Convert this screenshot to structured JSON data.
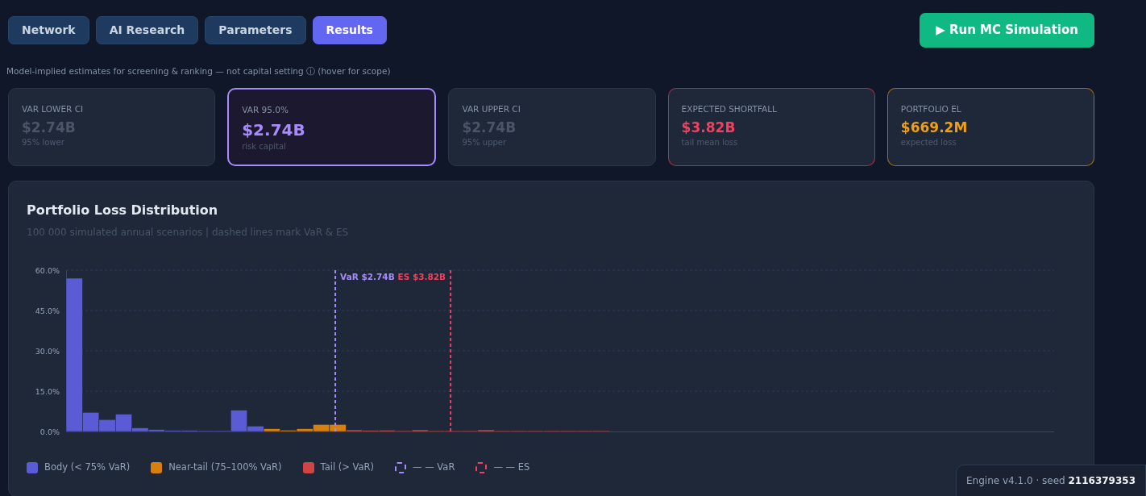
{
  "tabs": [
    {
      "label": "Network",
      "selected": false
    },
    {
      "label": "AI Research",
      "selected": false
    },
    {
      "label": "Parameters",
      "selected": false
    },
    {
      "label": "Results",
      "selected": true
    }
  ],
  "run_button": {
    "icon": "▶",
    "label": "Run MC Simulation"
  },
  "disclaimer": "Model-implied estimates for screening & ranking — not capital setting ⓘ (hover for scope)",
  "metrics": [
    {
      "kind": "dim",
      "color": "#4b5567",
      "label": "VAR LOWER CI",
      "value": "$2.74B",
      "note": "95% lower"
    },
    {
      "kind": "highlight",
      "color": "#a78bfa",
      "label": "VAR 95.0%",
      "value": "$2.74B",
      "note": "risk capital"
    },
    {
      "kind": "dim",
      "color": "#4b5567",
      "label": "VAR UPPER CI",
      "value": "$2.74B",
      "note": "95% upper"
    },
    {
      "kind": "accent",
      "color": "#f43f5e",
      "label": "EXPECTED SHORTFALL",
      "value": "$3.82B",
      "note": "tail mean loss"
    },
    {
      "kind": "accent",
      "color": "#f59e0b",
      "label": "PORTFOLIO EL",
      "value": "$669.2M",
      "note": "expected loss"
    }
  ],
  "panel": {
    "title": "Portfolio Loss Distribution",
    "subtitle": "100 000 simulated annual scenarios | dashed lines mark VaR & ES",
    "chart_data": {
      "type": "bar",
      "stacked": true,
      "grid": true,
      "ylim": [
        0,
        60
      ],
      "yticks": [
        {
          "value": 0,
          "label": "0.0%"
        },
        {
          "value": 15,
          "label": "15.0%"
        },
        {
          "value": 30,
          "label": "30.0%"
        },
        {
          "value": 45,
          "label": "45.0%"
        },
        {
          "value": 60,
          "label": "60.0%"
        }
      ],
      "series": [
        {
          "name": "Body (< 75% VaR)",
          "color": "#5b5bd6",
          "values": [
            57.0,
            7.1,
            4.4,
            6.4,
            1.3,
            0.7,
            0.4,
            0.4,
            0.1,
            0.1,
            7.9,
            2.0,
            null,
            null,
            null,
            null,
            null,
            null,
            null,
            null,
            null,
            null,
            null,
            null,
            null,
            null,
            null,
            null,
            null,
            null,
            null,
            null,
            null,
            null,
            null,
            null,
            null,
            null,
            null,
            null,
            null,
            null,
            null,
            null,
            null,
            null,
            null,
            null,
            null,
            null,
            null,
            null,
            null,
            null,
            null,
            null,
            null,
            null,
            null,
            null
          ]
        },
        {
          "name": "Near-tail (75–100% VaR)",
          "color": "#d97f0e",
          "values": [
            null,
            null,
            null,
            null,
            null,
            null,
            null,
            null,
            null,
            null,
            null,
            null,
            1.0,
            0.5,
            1.0,
            2.6,
            2.6,
            null,
            null,
            null,
            null,
            null,
            null,
            null,
            null,
            null,
            null,
            null,
            null,
            null,
            null,
            null,
            null,
            null,
            null,
            null,
            null,
            null,
            null,
            null,
            null,
            null,
            null,
            null,
            null,
            null,
            null,
            null,
            null,
            null,
            null,
            null,
            null,
            null,
            null,
            null,
            null,
            null,
            null,
            null
          ]
        },
        {
          "name": "Tail (> VaR)",
          "color": "#d04444",
          "values": [
            null,
            null,
            null,
            null,
            null,
            null,
            null,
            null,
            null,
            null,
            null,
            null,
            null,
            null,
            null,
            null,
            null,
            0.6,
            0.4,
            0.5,
            0.1,
            0.6,
            0.1,
            0.1,
            0.1,
            0.6,
            0.1,
            0.1,
            0.1,
            0.1,
            0.1,
            0.1,
            0.1,
            0,
            0,
            0,
            0,
            0,
            0,
            0,
            0,
            0,
            0,
            0,
            0,
            0,
            0,
            0,
            0,
            0,
            0,
            0,
            0,
            0,
            0,
            0,
            0,
            0,
            0,
            0
          ]
        }
      ]
    },
    "thresholds": [
      {
        "kind": "var",
        "label": "VaR $2.74B",
        "color": "#a78bfa"
      },
      {
        "kind": "es",
        "label": "ES $3.82B",
        "color": "#f43f5e"
      }
    ],
    "legend": [
      {
        "kind": "dashed",
        "color": "#a78bfa",
        "label": "— — VaR"
      },
      {
        "kind": "dashed",
        "color": "#f43f5e",
        "label": "— — ES"
      }
    ]
  },
  "engine": {
    "text": "Engine v4.1.0 · seed",
    "seed": "2116379353"
  }
}
